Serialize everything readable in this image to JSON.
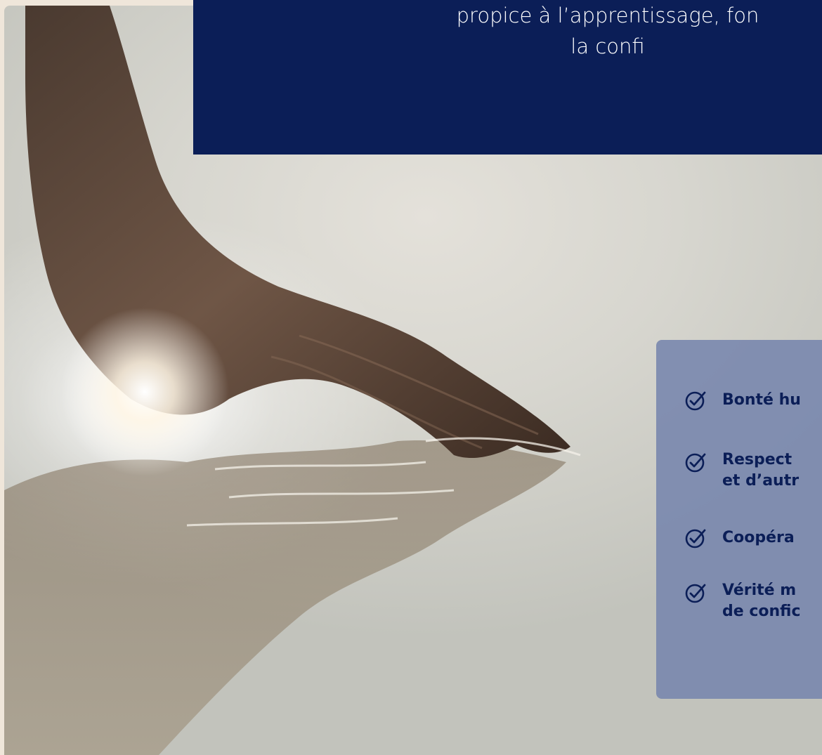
{
  "hero": {
    "image_alt": "Main effleurant la surface de l’eau au soleil"
  },
  "quote": {
    "text": "formation, créant un environne\npropice à l’apprentissage, fon\nla confi"
  },
  "values": {
    "items": [
      {
        "label": "Bonté hu",
        "icon": "check-circle-icon"
      },
      {
        "label": "Respect\net d’autr",
        "icon": "check-circle-icon"
      },
      {
        "label": "Coopéra",
        "icon": "check-circle-icon"
      },
      {
        "label": "Vérité m\nde confic",
        "icon": "check-circle-icon"
      }
    ]
  },
  "colors": {
    "navy": "#0b1e57",
    "panel": "#7484ac",
    "background": "#efe6da"
  }
}
